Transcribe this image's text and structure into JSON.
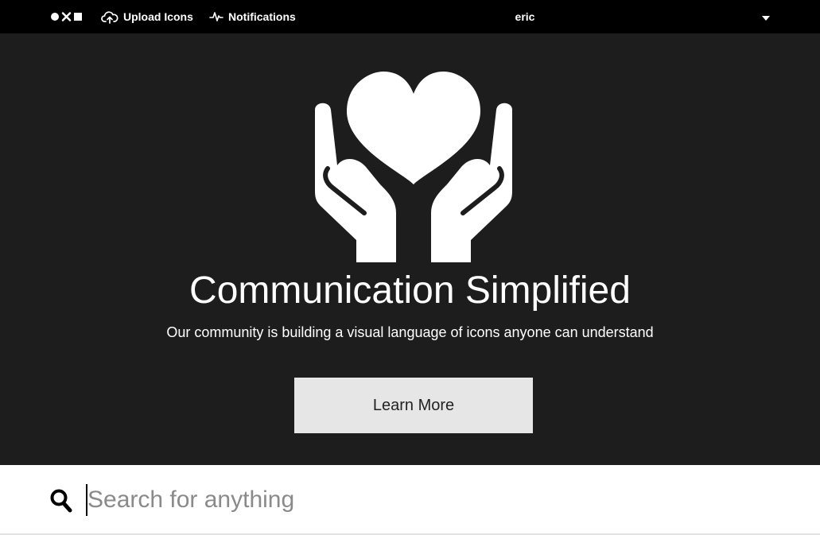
{
  "colors": {
    "topbar_bg": "#000000",
    "hero_bg": "#1d1d1d",
    "hero_text": "#ffffff",
    "button_bg": "#e6e6e6",
    "button_text": "#222222",
    "search_placeholder": "#8a8a8a"
  },
  "header": {
    "logo_icon": "circle-x-square-logo",
    "nav": [
      {
        "label": "Upload Icons",
        "icon": "cloud-upload-icon"
      },
      {
        "label": "Notifications",
        "icon": "activity-pulse-icon"
      }
    ],
    "user": {
      "name": "eric",
      "menu_icon": "caret-down-icon"
    }
  },
  "hero": {
    "art_icon": "hands-holding-heart-icon",
    "title": "Communication Simplified",
    "subtitle": "Our community is building a visual language of icons anyone can understand",
    "button_label": "Learn More"
  },
  "search": {
    "icon": "search-icon",
    "placeholder": "Search for anything",
    "value": ""
  }
}
